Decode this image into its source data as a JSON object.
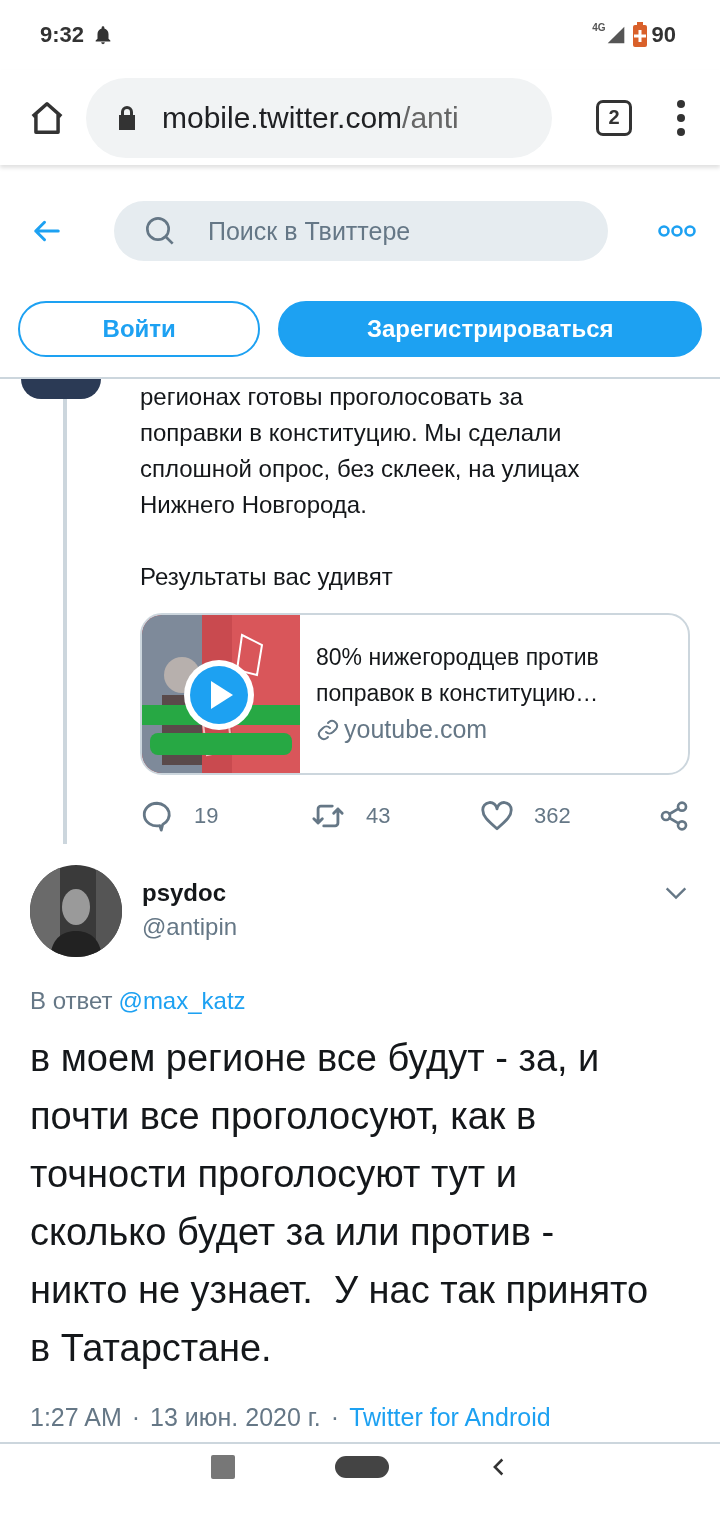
{
  "status_bar": {
    "time": "9:32",
    "network": "4G",
    "battery": "90"
  },
  "browser": {
    "url_host": "mobile.twitter.com",
    "url_path": "/anti",
    "tab_count": "2"
  },
  "header": {
    "search_placeholder": "Поиск в Твиттере"
  },
  "auth_buttons": [
    {
      "label": "Войти",
      "kind": "outline"
    },
    {
      "label": "Зарегистрироваться",
      "kind": "filled"
    }
  ],
  "parent_tweet": {
    "text": "регионах готовы проголосовать за поправки в конституцию. Мы сделали сплошной опрос, без склеек, на улицах Нижнего Новгорода.",
    "text_2": "Результаты вас удивят",
    "card": {
      "kind": "picture",
      "title": "80% нижегородцев против поправок в конституцию…",
      "domain": "youtube.com"
    },
    "actions": [
      {
        "kind": "reply",
        "count": "19"
      },
      {
        "kind": "retweet",
        "count": "43"
      },
      {
        "kind": "like",
        "count": "362"
      },
      {
        "kind": "share"
      }
    ]
  },
  "tweet": {
    "name": "psydoc",
    "handle": "@antipin",
    "reply_prefix": "В ответ",
    "reply_to": "@max_katz",
    "text": "в моем регионе все будут - за, и почти все проголосуют, как в точности проголосуют тут и сколько будет за или против - никто не узнает.  У нас так принято в Татарстане.",
    "time": "1:27 AM",
    "separator": "·",
    "date": "13 июн. 2020 г.",
    "source": "Twitter for Android"
  }
}
